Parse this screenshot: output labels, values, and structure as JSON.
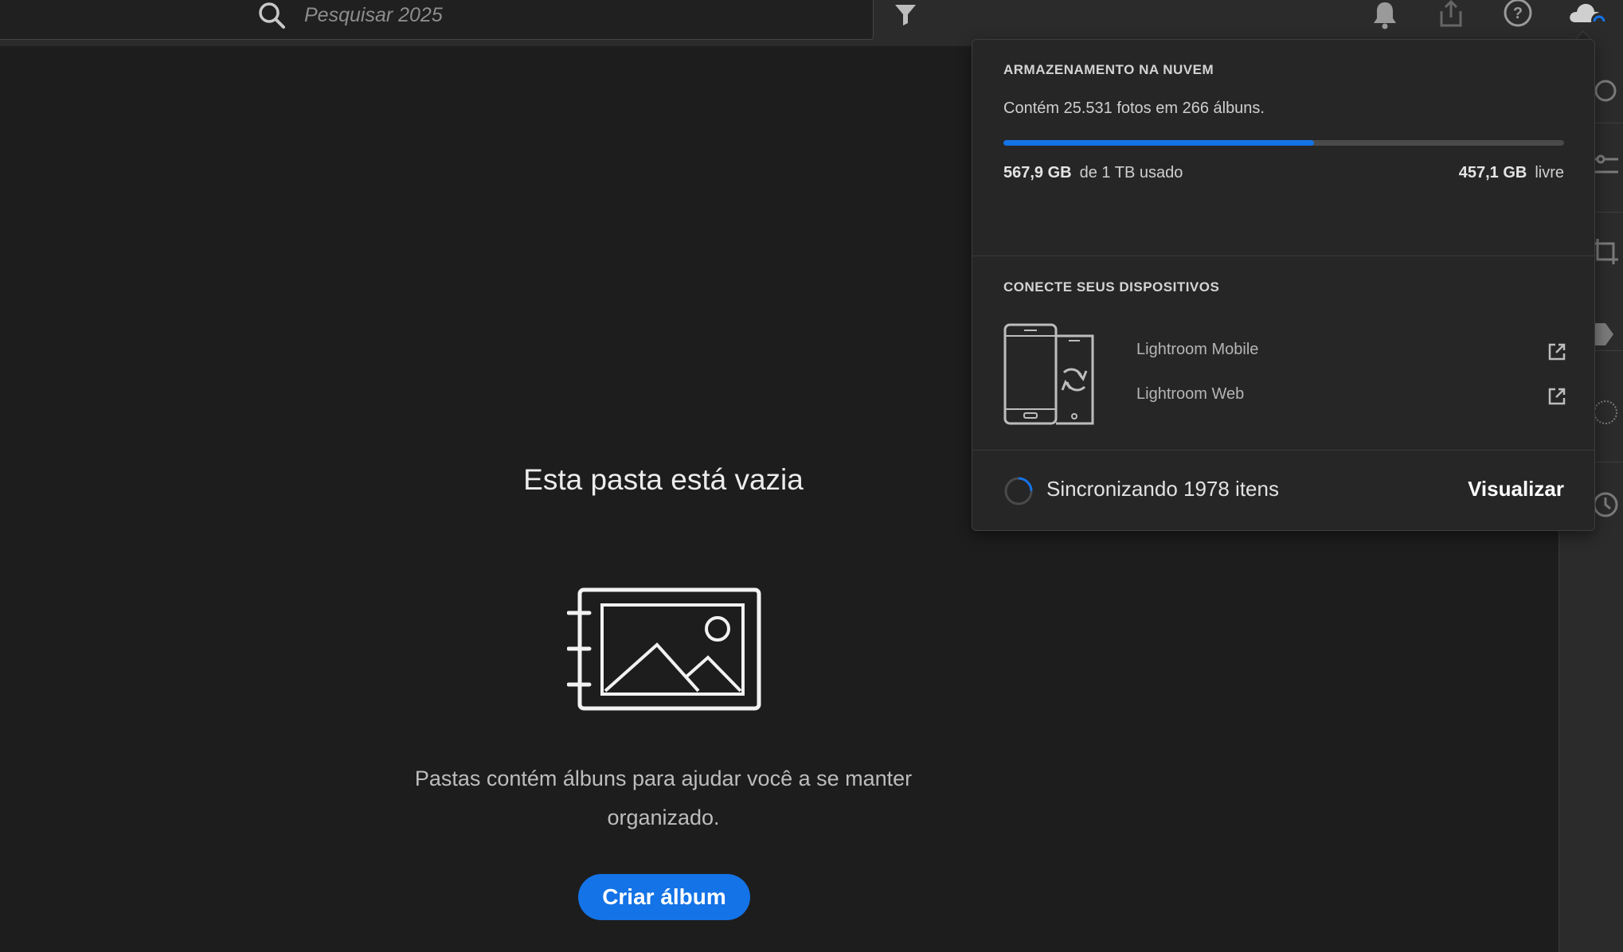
{
  "search": {
    "placeholder": "Pesquisar 2025"
  },
  "topbar": {
    "icons": [
      "search-icon",
      "filter-icon",
      "bell-icon",
      "share-icon",
      "help-icon",
      "cloud-sync-icon"
    ]
  },
  "empty_state": {
    "title": "Esta pasta está vazia",
    "description": "Pastas contém álbuns para ajudar você a se manter organizado.",
    "create_button": "Criar álbum",
    "illustration": "album-illustration"
  },
  "cloud_popover": {
    "storage_heading": "ARMAZENAMENTO NA NUVEM",
    "storage_summary": "Contém 25.531 fotos em 266 álbuns.",
    "used_amount": "567,9 GB",
    "used_label": "de 1 TB usado",
    "free_amount": "457,1 GB",
    "free_label": "livre",
    "usage_fraction": 0.5535,
    "devices_heading": "CONECTE SEUS DISPOSITIVOS",
    "apps": [
      {
        "label": "Lightroom Mobile",
        "icon": "external-link-icon"
      },
      {
        "label": "Lightroom Web",
        "icon": "external-link-icon"
      }
    ],
    "sync_status": "Sincronizando 1978 itens",
    "view_link": "Visualizar"
  },
  "colors": {
    "accent": "#1473e6",
    "background": "#1d1d1d",
    "panel": "#262626",
    "topbar": "#2b2b2b"
  }
}
